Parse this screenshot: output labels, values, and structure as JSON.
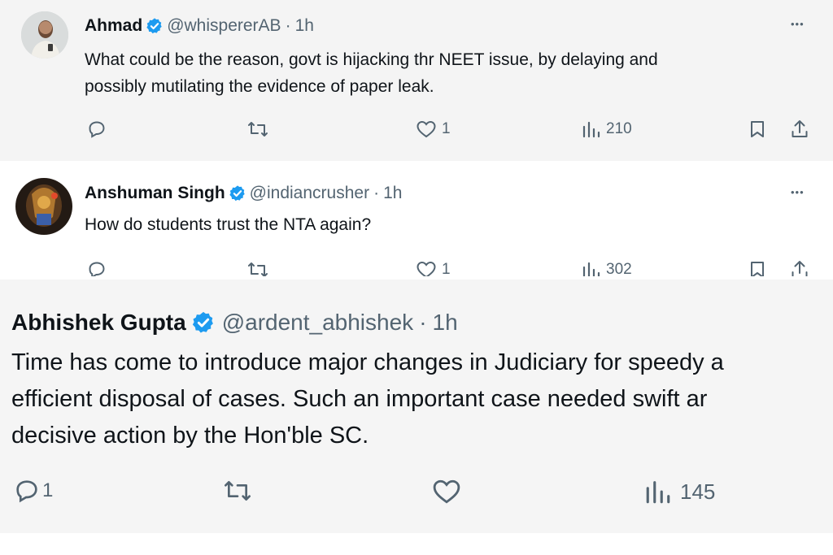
{
  "tweets": [
    {
      "name": "Ahmad",
      "handle": "@whispererAB",
      "sep": "·",
      "time": "1h",
      "more": "•••",
      "lines": [
        "What could be the reason, govt is hijacking thr NEET issue, by delaying and",
        "possibly mutilating the evidence of paper leak."
      ],
      "likes": "1",
      "views": "210"
    },
    {
      "name": "Anshuman Singh",
      "handle": "@indiancrusher",
      "sep": "·",
      "time": "1h",
      "more": "•••",
      "lines": [
        "How do students trust the NTA again?"
      ],
      "likes": "1",
      "views": "302"
    },
    {
      "name": "Abhishek Gupta",
      "handle": "@ardent_abhishek",
      "sep": "·",
      "time": "1h",
      "lines": [
        "Time has come to introduce major changes in Judiciary for speedy a",
        "efficient disposal of cases. Such an important case needed swift ar",
        "decisive action by the Hon'ble SC."
      ],
      "replies": "1",
      "views": "145"
    }
  ],
  "colors": {
    "verified": "#1d9bf0",
    "text": "#0f1419",
    "muted": "#536471"
  }
}
